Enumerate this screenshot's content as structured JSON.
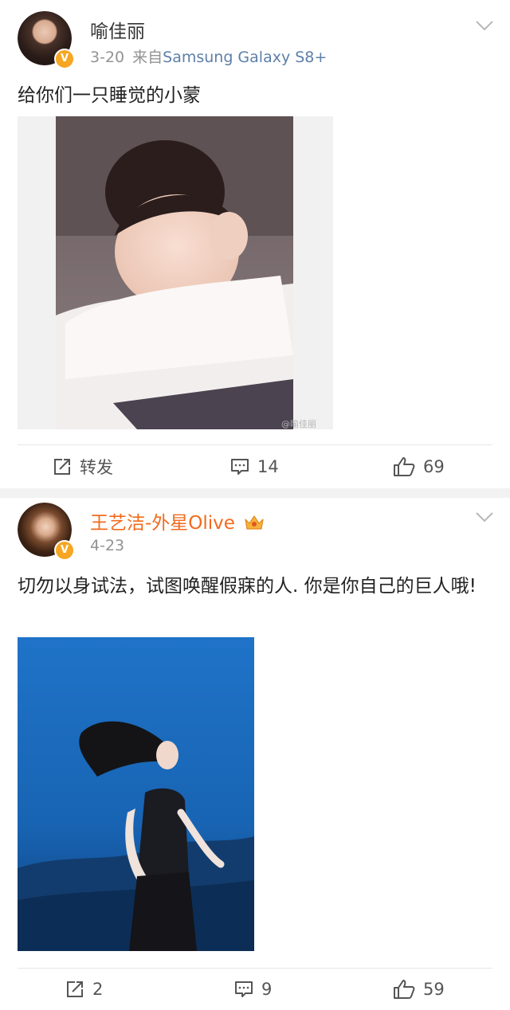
{
  "posts": [
    {
      "author": "喻佳丽",
      "verified": true,
      "date": "3-20",
      "source_prefix": "来自",
      "source": "Samsung Galaxy S8+",
      "text": "给你们一只睡觉的小蒙",
      "image_watermark": "@喻佳丽",
      "actions": {
        "repost": "转发",
        "comments": "14",
        "likes": "69"
      }
    },
    {
      "author": "王艺洁-外星Olive",
      "author_color": "#f26b1d",
      "verified": true,
      "member_badge": "crown-icon",
      "date": "4-23",
      "text": "切勿以身试法，试图唤醒假寐的人. 你是你自己的巨人哦!",
      "actions": {
        "repost": "2",
        "comments": "9",
        "likes": "59"
      }
    }
  ],
  "colors": {
    "verified_badge": "#f6a623",
    "source_link": "#5d7fa8",
    "meta_text": "#939393",
    "separator": "#f2f2f2"
  }
}
